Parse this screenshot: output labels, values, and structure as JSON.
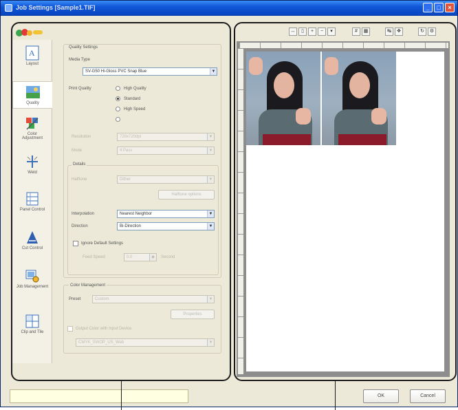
{
  "window": {
    "title": "Job Settings [Sample1.TIF]"
  },
  "sidebar": {
    "items": [
      {
        "label": "Layout",
        "icon": "layout-icon"
      },
      {
        "label": "Quality",
        "icon": "quality-icon",
        "active": true
      },
      {
        "label": "Color Adjustment",
        "icon": "color-adjustment-icon"
      },
      {
        "label": "Weld",
        "icon": "weld-icon"
      },
      {
        "label": "Panel Control",
        "icon": "panel-control-icon"
      },
      {
        "label": "Cut Control",
        "icon": "cut-control-icon"
      },
      {
        "label": "Job Management",
        "icon": "job-management-icon"
      },
      {
        "label": "Clip and Tile",
        "icon": "clip-and-tile-icon"
      }
    ]
  },
  "quality": {
    "group_title": "Quality Settings",
    "media_type_label": "Media Type",
    "media_type_value": "SV-G50 Hi-Gloss PVC Snap Blue",
    "print_quality_label": "Print Quality",
    "pq_high_quality": "High Quality",
    "pq_standard": "Standard",
    "pq_high_speed": "High Speed",
    "resolution_label": "Resolution",
    "resolution_value": "720x720dpi",
    "mode_label": "Mode",
    "mode_value": "4 Pass",
    "details_label": "Details",
    "halftone_label": "Halftone",
    "halftone_value": "Dither",
    "halftone_button": "Halftone options",
    "interpolation_label": "Interpolation",
    "interpolation_value": "Nearest Neighbor",
    "direction_label": "Direction",
    "direction_value": "Bi-Direction",
    "ignore_default_label": "Ignore Default Settings",
    "feed_speed_label": "Feed Speed",
    "feed_speed_value": "0.0",
    "feed_speed_unit": "Second"
  },
  "color_management": {
    "group_title": "Color Management",
    "preset_label": "Preset",
    "preset_value": "Custom",
    "properties_button": "Properties",
    "output_label": "Output Color with Input Device",
    "output_value": "CMYK_SWOP_US_Web"
  },
  "buttons": {
    "ok": "OK",
    "cancel": "Cancel"
  }
}
